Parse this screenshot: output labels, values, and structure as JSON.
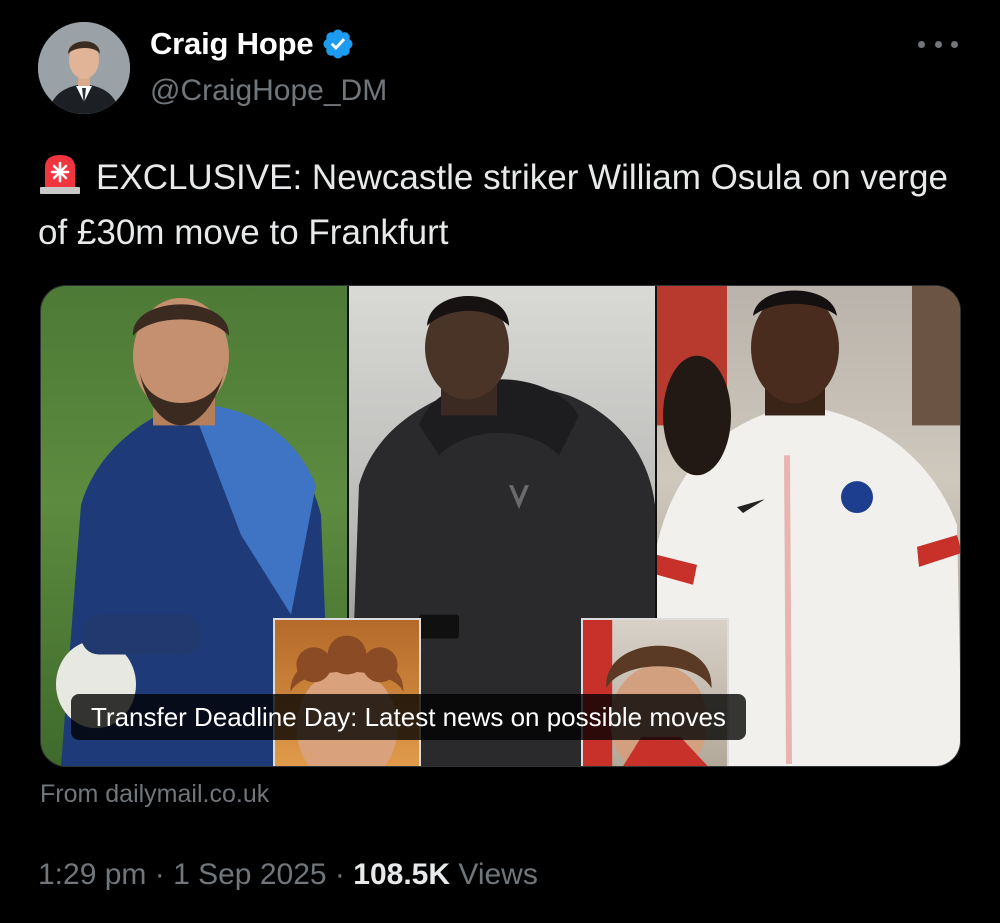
{
  "author": {
    "display_name": "Craig Hope",
    "handle": "@CraigHope_DM",
    "verified": true
  },
  "tweet": {
    "leading_emoji": "rotating-light-icon",
    "text": "EXCLUSIVE: Newcastle striker William Osula on verge of £30m move to Frankfurt"
  },
  "card": {
    "caption": "Transfer Deadline Day: Latest news on possible moves",
    "source": "From dailymail.co.uk"
  },
  "meta": {
    "time": "1:29 pm",
    "separator1": "·",
    "date": "1 Sep 2025",
    "separator2": "·",
    "views_count": "108.5K",
    "views_label": "Views"
  },
  "colors": {
    "background": "#000000",
    "primary_text": "#e7e9ea",
    "secondary_text": "#71767b",
    "verified_blue": "#1d9bf0"
  },
  "icons": {
    "verified": "verified-badge-icon",
    "more": "more-options-icon",
    "siren": "rotating-light-icon"
  }
}
